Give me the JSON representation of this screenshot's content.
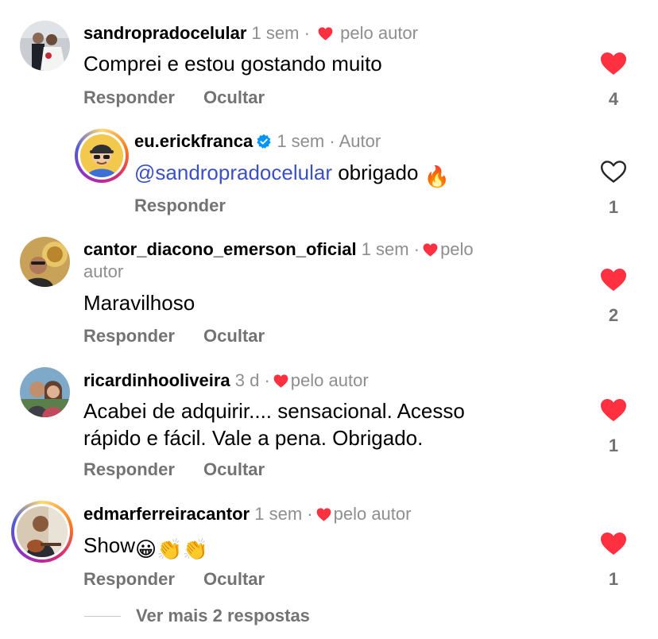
{
  "colors": {
    "like_red": "#ff3040",
    "mention_blue": "#3b4fc6",
    "muted": "#737373",
    "verified_blue": "#0095f6"
  },
  "comments": [
    {
      "username": "sandropradocelular",
      "time": "1 sem",
      "separator": "·",
      "badge": "pelo autor",
      "text": "Comprei e estou gostando muito",
      "reply_label": "Responder",
      "hide_label": "Ocultar",
      "liked": true,
      "like_count": "4",
      "avatar_icon": "wedding-couple-photo"
    },
    {
      "username": "eu.erickfranca",
      "verified": true,
      "time": "1 sem",
      "separator": "·",
      "badge": "Autor",
      "mention": "@sandropradocelular",
      "text": "obrigado",
      "emoji": "🔥",
      "reply_label": "Responder",
      "liked": false,
      "like_count": "1",
      "avatar_icon": "cartoon-man-cap-sunglasses"
    },
    {
      "username": "cantor_diacono_emerson_oficial",
      "time": "1 sem",
      "separator": "·",
      "badge_line1": "pelo",
      "badge_line2": "autor",
      "text": "Maravilhoso",
      "reply_label": "Responder",
      "hide_label": "Ocultar",
      "liked": true,
      "like_count": "2",
      "avatar_icon": "man-with-award-photo"
    },
    {
      "username": "ricardinhooliveira",
      "time": "3 d",
      "separator": "·",
      "badge": "pelo autor",
      "text_line1": "Acabei de adquirir.... sensacional. Acesso",
      "text_line2": "rápido e fácil.  Vale a pena.  Obrigado.",
      "reply_label": "Responder",
      "hide_label": "Ocultar",
      "liked": true,
      "like_count": "1",
      "avatar_icon": "couple-selfie-photo"
    },
    {
      "username": "edmarferreiracantor",
      "time": "1 sem",
      "separator": "·",
      "badge": "pelo autor",
      "text": "Show",
      "emojis": [
        "😀",
        "👏",
        "👏"
      ],
      "reply_label": "Responder",
      "hide_label": "Ocultar",
      "liked": true,
      "like_count": "1",
      "avatar_icon": "man-with-guitar-photo"
    }
  ],
  "more_replies": "Ver mais 2 respostas"
}
